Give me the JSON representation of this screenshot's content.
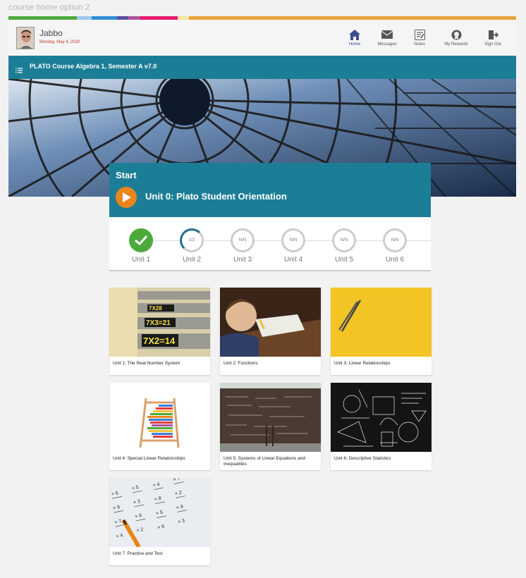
{
  "page_label": "course home option 2",
  "colors": {
    "bar_segments": [
      "#4caa3c",
      "#9dc9e8",
      "#2f8fd6",
      "#5a4fa0",
      "#b0539c",
      "#e8186e",
      "#f2e6a0",
      "#e8a53a"
    ],
    "teal": "#1c7e96",
    "orange": "#e8861b",
    "green": "#4caa3c"
  },
  "user": {
    "name": "Jabbo",
    "date": "Monday, May 4, 2020"
  },
  "nav": [
    {
      "label": "Home",
      "icon": "home-icon"
    },
    {
      "label": "Messages",
      "icon": "envelope-icon"
    },
    {
      "label": "Notes",
      "icon": "notes-icon"
    },
    {
      "label": "My Rewards",
      "icon": "rewards-icon"
    },
    {
      "label": "Sign Out",
      "icon": "sign-out-icon"
    }
  ],
  "course": {
    "title": "PLATO Course Algebra 1, Semester A v7.0"
  },
  "start": {
    "label": "Start",
    "unit": "Unit 0: Plato Student Orientation"
  },
  "progress": [
    {
      "label": "Unit 1",
      "status": "complete",
      "text": ""
    },
    {
      "label": "Unit 2",
      "status": "partial",
      "text": "1/2"
    },
    {
      "label": "Unit 3",
      "status": "none",
      "text": "N/N"
    },
    {
      "label": "Unit 4",
      "status": "none",
      "text": "N/N"
    },
    {
      "label": "Unit 5",
      "status": "none",
      "text": "N/N"
    },
    {
      "label": "Unit 6",
      "status": "none",
      "text": "N/N"
    }
  ],
  "units": [
    {
      "title": "Unit 1: The Real Number System"
    },
    {
      "title": "Unit 2: Functions"
    },
    {
      "title": "Unit 3: Linear Relationships"
    },
    {
      "title": "Unit 4: Special Linear Relationships"
    },
    {
      "title": "Unit 5: Systems of Linear Equations and Inequalities"
    },
    {
      "title": "Unit 6: Descriptive Statistics"
    },
    {
      "title": "Unit 7: Practice and Test"
    }
  ],
  "unit1_image_text": [
    "7X28",
    "7X3=21",
    "7X2=14"
  ]
}
